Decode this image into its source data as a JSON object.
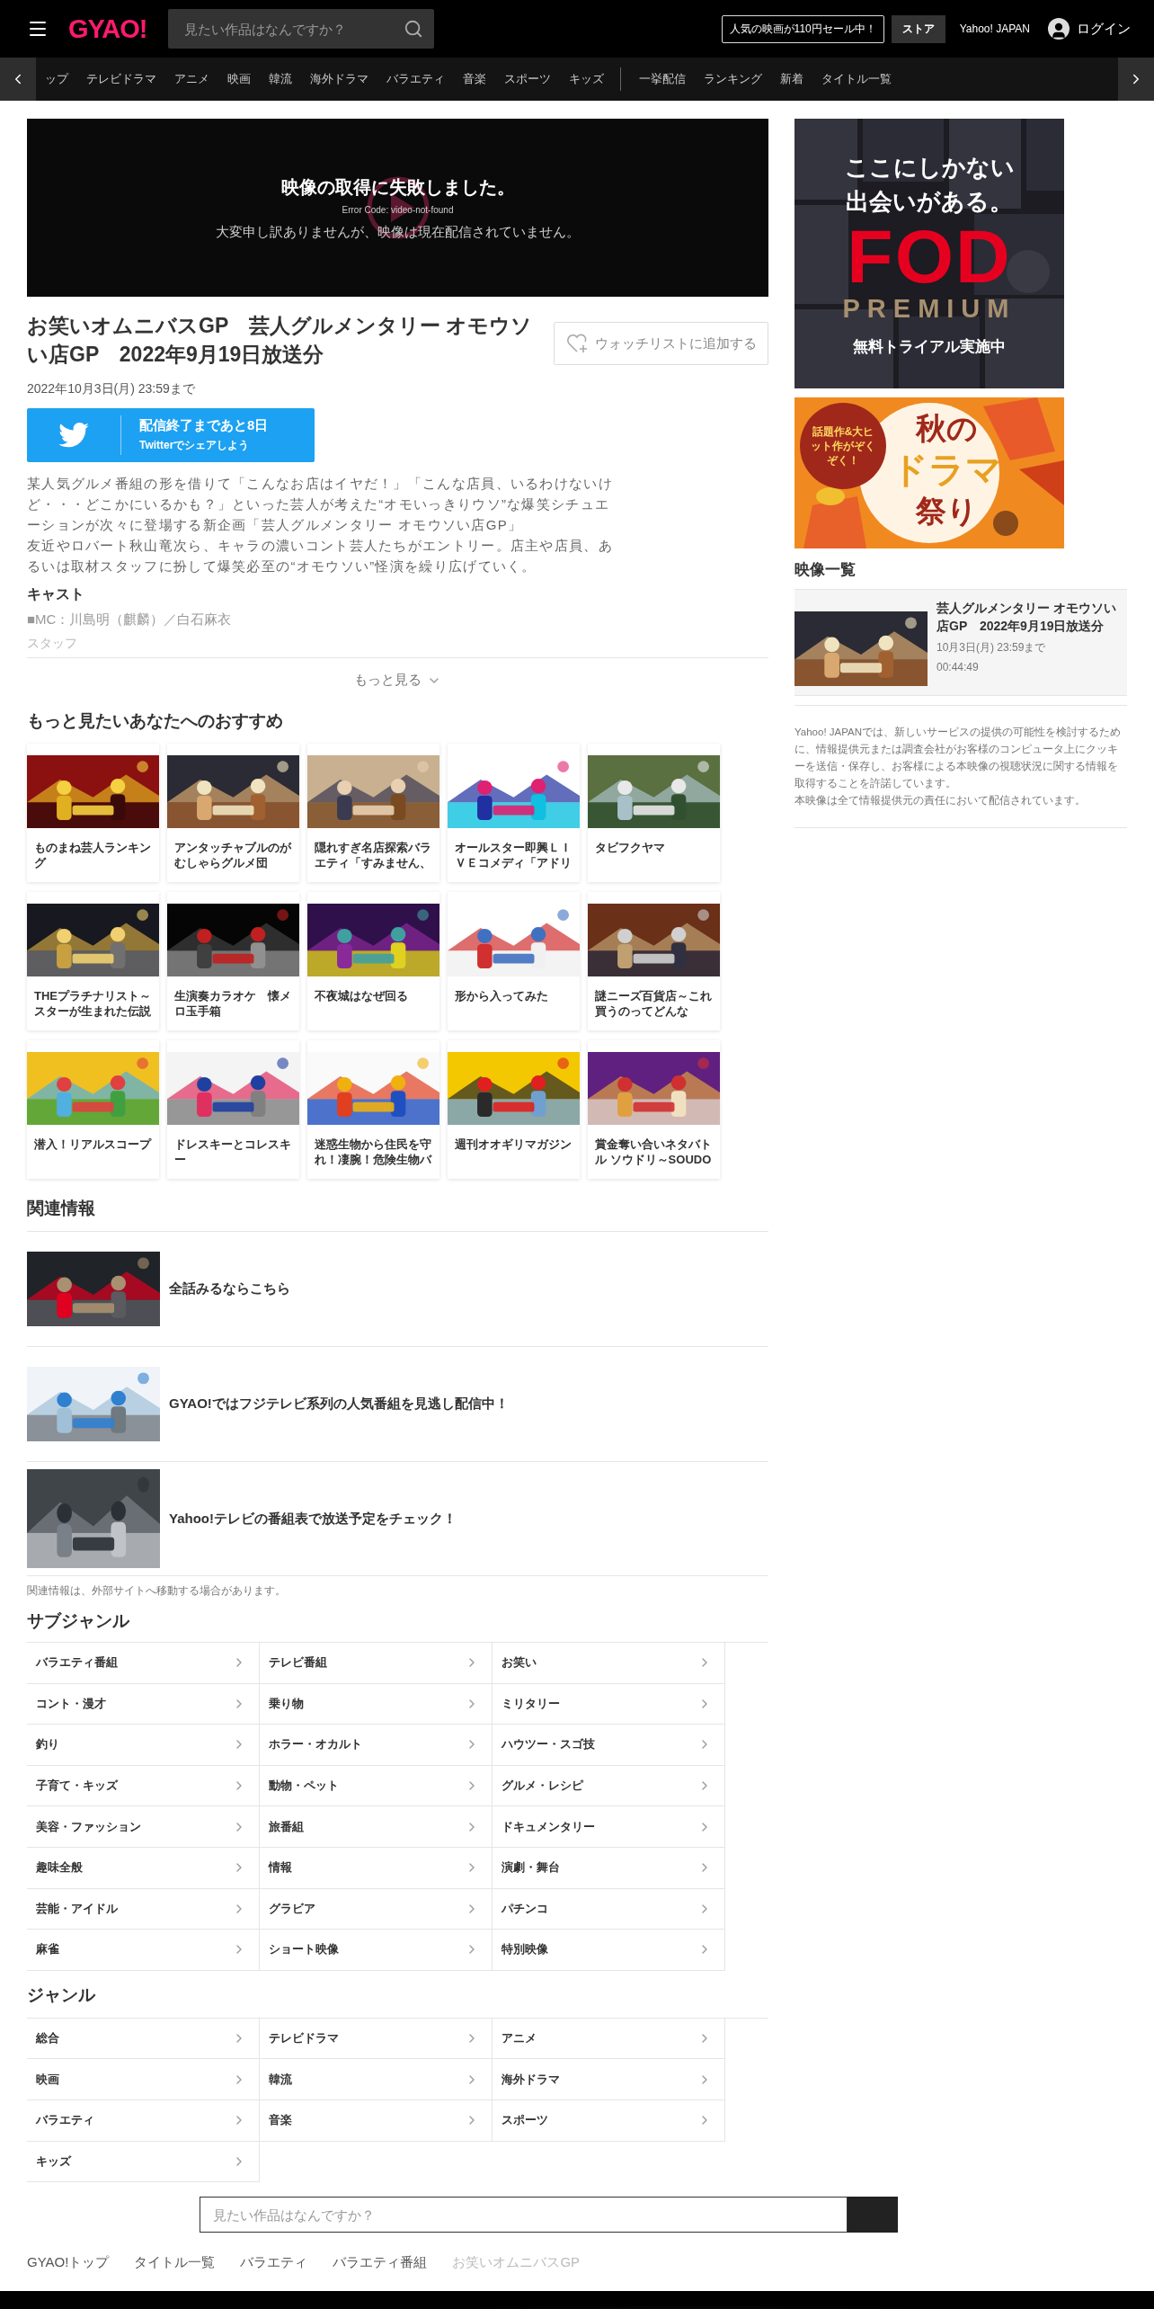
{
  "header": {
    "logo": "GYAO!",
    "search": {
      "placeholder": "見たい作品はなんですか？"
    },
    "promo": "人気の映画が110円セール中！",
    "store": "ストア",
    "portal": "Yahoo! JAPAN",
    "login": "ログイン"
  },
  "nav": {
    "genres": [
      "ップ",
      "テレビドラマ",
      "アニメ",
      "映画",
      "韓流",
      "海外ドラマ",
      "バラエティ",
      "音楽",
      "スポーツ",
      "キッズ"
    ],
    "features": [
      "一挙配信",
      "ランキング",
      "新着",
      "タイトル一覧"
    ]
  },
  "player": {
    "error_title": "映像の取得に失敗しました。",
    "error_code": "Error Code: video-not-found",
    "message": "大変申し訳ありませんが、映像は現在配信されていません。"
  },
  "episode": {
    "title": "お笑いオムニバスGP　芸人グルメンタリー オモウソい店GP　2022年9月19日放送分",
    "watchlist": "ウォッチリストに追加する",
    "available_until": "2022年10月3日(月) 23:59まで",
    "share": {
      "headline": "配信終了まであと8日",
      "sub": "Twitterでシェアしよう"
    },
    "description": [
      "某人気グルメ番組の形を借りて「こんなお店はイヤだ！」「こんな店員、いるわけないけど・・・どこかにいるかも？」といった芸人が考えた“オモいっきりウソ”な爆笑シチュエーションが次々に登場する新企画「芸人グルメンタリー オモウソい店GP」",
      "友近やロバート秋山竜次ら、キャラの濃いコント芸人たちがエントリー。店主や店員、あるいは取材スタッフに扮して爆笑必至の“オモウソい”怪演を繰り広げていく。"
    ],
    "cast_heading": "キャスト",
    "cast": "■MC：川島明（麒麟）／白石麻衣",
    "staff_heading": "スタッフ",
    "more": "もっと見る"
  },
  "recommendations": {
    "heading": "もっと見たいあなたへのおすすめ",
    "items": [
      {
        "title": "ものまね芸人ランキング"
      },
      {
        "title": "アンタッチャブルのがむしゃらグルメ団"
      },
      {
        "title": "隠れすぎ名店探索バラエティ「すみません、"
      },
      {
        "title": "オールスター即興ＬＩＶＥコメディ「アドリ"
      },
      {
        "title": "タビフクヤマ"
      },
      {
        "title": "THEプラチナリスト～スターが生まれた伝説"
      },
      {
        "title": "生演奏カラオケ　懐メロ玉手箱"
      },
      {
        "title": "不夜城はなぜ回る"
      },
      {
        "title": "形から入ってみた"
      },
      {
        "title": "謎ニーズ百貨店～これ買うのってどんな"
      },
      {
        "title": "潜入！リアルスコープ"
      },
      {
        "title": "ドレスキーとコレスキー"
      },
      {
        "title": "迷惑生物から住民を守れ！凄腕！危険生物バ"
      },
      {
        "title": "週刊オオギリマガジン"
      },
      {
        "title": "賞金奪い合いネタバトル ソウドリ～SOUDO"
      }
    ]
  },
  "related": {
    "heading": "関連情報",
    "items": [
      {
        "label": "全話みるならこちら",
        "kind": "picture"
      },
      {
        "label": "GYAO!ではフジテレビ系列の人気番組を見逃し配信中！",
        "kind": "picture"
      },
      {
        "label": "Yahoo!テレビの番組表で放送予定をチェック！",
        "kind": "picture"
      }
    ],
    "note": "関連情報は、外部サイトへ移動する場合があります。"
  },
  "subgenres": {
    "heading": "サブジャンル",
    "items": [
      "バラエティ番組",
      "テレビ番組",
      "お笑い",
      "コント・漫才",
      "乗り物",
      "ミリタリー",
      "釣り",
      "ホラー・オカルト",
      "ハウツー・スゴ技",
      "子育て・キッズ",
      "動物・ペット",
      "グルメ・レシピ",
      "美容・ファッション",
      "旅番組",
      "ドキュメンタリー",
      "趣味全般",
      "情報",
      "演劇・舞台",
      "芸能・アイドル",
      "グラビア",
      "パチンコ",
      "麻雀",
      "ショート映像",
      "特別映像"
    ]
  },
  "genres": {
    "heading": "ジャンル",
    "items": [
      "総合",
      "テレビドラマ",
      "アニメ",
      "映画",
      "韓流",
      "海外ドラマ",
      "バラエティ",
      "音楽",
      "スポーツ",
      "キッズ"
    ]
  },
  "bottom_search": {
    "placeholder": "見たい作品はなんですか？"
  },
  "breadcrumb": [
    {
      "label": "GYAO!トップ",
      "current": false
    },
    {
      "label": "タイトル一覧",
      "current": false
    },
    {
      "label": "バラエティ",
      "current": false
    },
    {
      "label": "バラエティ番組",
      "current": false
    },
    {
      "label": "お笑いオムニバスGP",
      "current": true
    }
  ],
  "sidebar": {
    "fod_ad": {
      "tagline": "ここにしかない出会いがある。",
      "brand": "FOD",
      "tier": "PREMIUM",
      "offer": "無料トライアル実施中"
    },
    "drama_ad": {
      "badge": "話題作&大ヒット作がぞくぞく！",
      "line1": "秋の",
      "line2": "ドラマ",
      "line3": "祭り"
    },
    "videos_heading": "映像一覧",
    "videos": [
      {
        "title": "芸人グルメンタリー オモウソい店GP　2022年9月19日放送分",
        "until": "10月3日(月) 23:59まで",
        "duration": "00:44:49"
      }
    ],
    "disclaimer": [
      "Yahoo! JAPANでは、新しいサービスの提供の可能性を検討するために、情報提供元または調査会社がお客様のコンピュータ上にクッキーを送信・保存し、お客様による本映像の視聴状況に関する情報を取得することを許諾しています。",
      "本映像は全て情報提供元の責任において配信されています。"
    ]
  }
}
